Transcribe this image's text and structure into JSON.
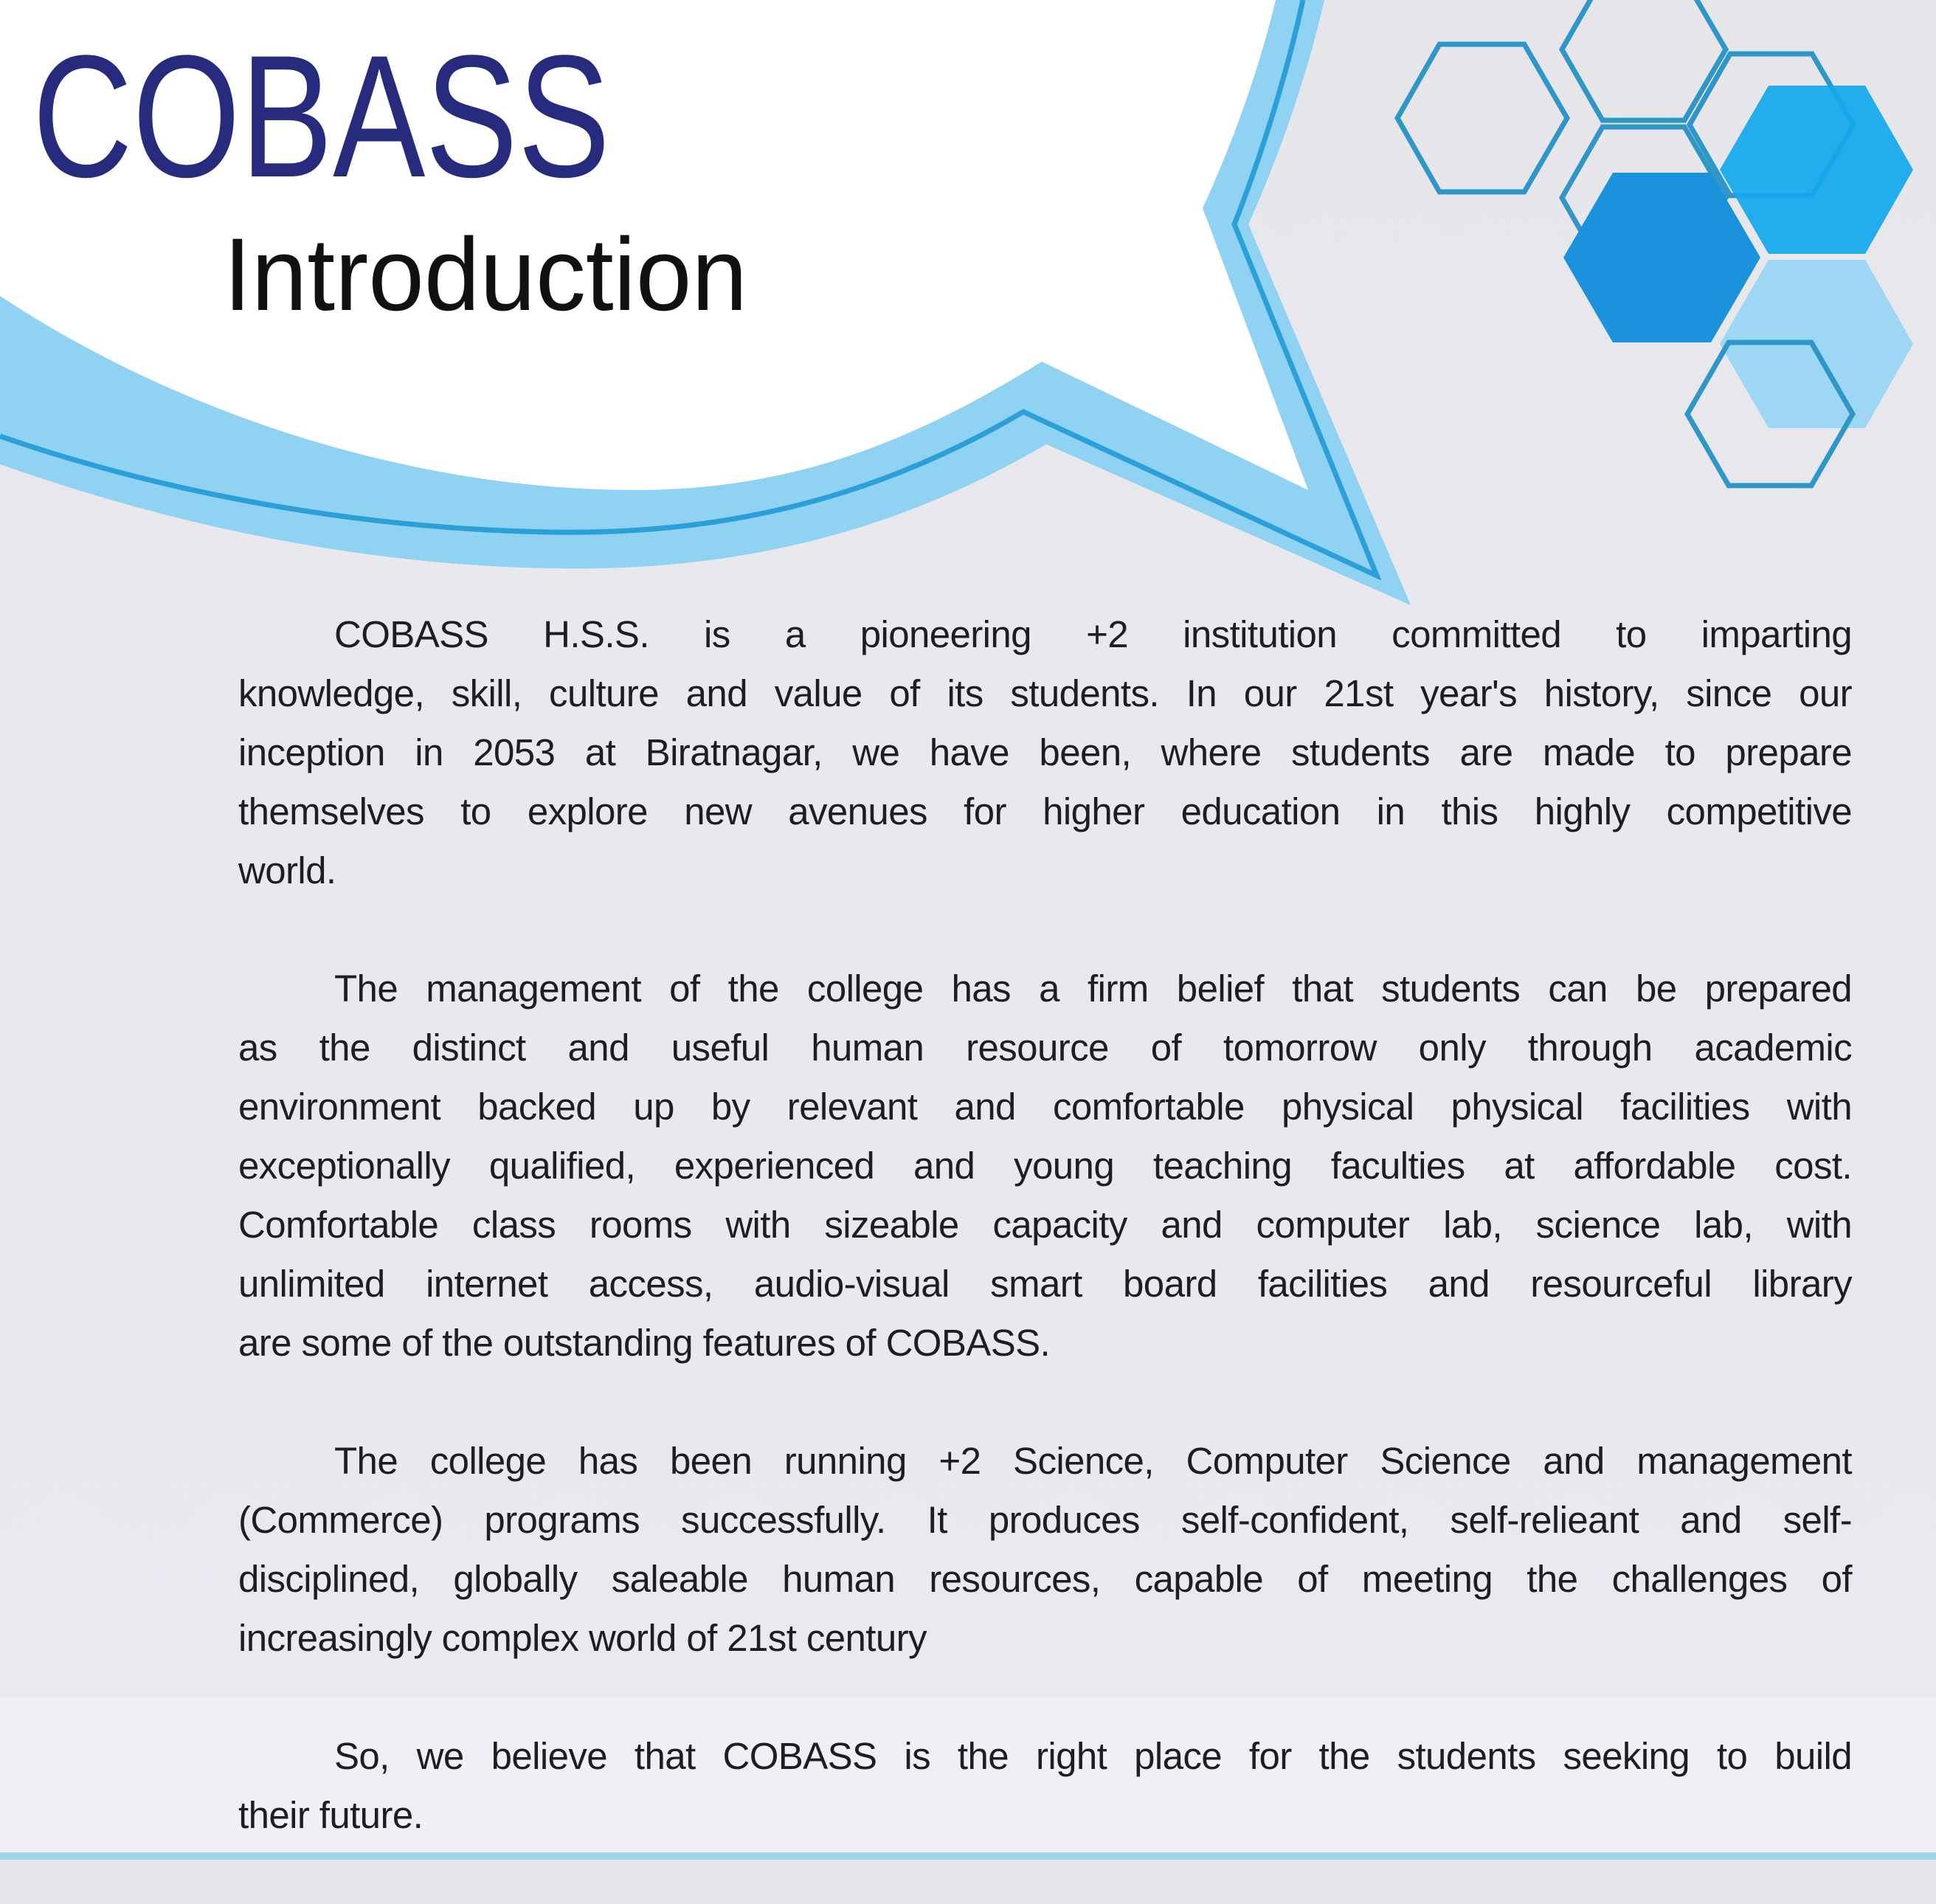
{
  "header": {
    "title": "COBASS",
    "subtitle": "Introduction"
  },
  "colors": {
    "title": "#262b7d",
    "bubble_band": "#8fd2f2",
    "bubble_line": "#2a9fd8",
    "hex_dark": "#1a93dc",
    "hex_mid": "#14a8ec",
    "hex_light": "#8fd4f6"
  },
  "paragraphs": [
    {
      "lines": [
        "COBASS H.S.S. is a pioneering +2 institution committed to imparting",
        "knowledge, skill, culture and value of its students. In our 21st year's history, since our",
        "inception in 2053 at Biratnagar, we have been, where students are made to prepare",
        "themselves to explore new avenues for higher education in this highly competitive",
        "world."
      ]
    },
    {
      "lines": [
        "The management of the college has a firm belief that students can be prepared",
        "as the distinct and useful human resource of tomorrow only  through academic",
        "environment backed up by relevant and comfortable physical physical facilities with",
        "exceptionally qualified, experienced and young teaching faculties at affordable cost.",
        "Comfortable class rooms with sizeable capacity and computer lab, science lab, with",
        "unlimited internet access, audio-visual smart board facilities and resourceful library",
        "are some of the outstanding features of COBASS."
      ]
    },
    {
      "lines": [
        "The college has been running +2 Science, Computer Science and management",
        "(Commerce) programs successfully. It produces self-confident, self-relieant and self-",
        "disciplined, globally saleable human resources, capable of meeting the challenges of",
        "increasingly complex world of 21st century"
      ]
    },
    {
      "lines": [
        "So, we believe that COBASS is the right place for the students seeking to build",
        "their future."
      ]
    }
  ]
}
